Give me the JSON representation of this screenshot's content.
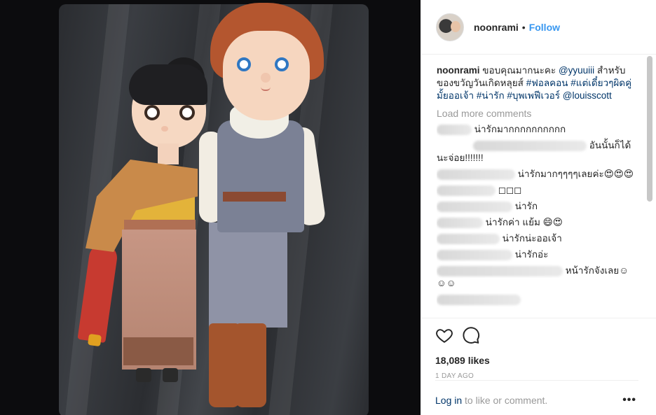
{
  "post": {
    "photo_alt": "fondant dolls in plastic bag"
  },
  "header": {
    "username": "noonrami",
    "separator": "•",
    "follow_label": "Follow"
  },
  "caption": {
    "username": "noonrami",
    "text_1": "ขอบคุณมากนะคะ",
    "mention_1": "@yyuuiii",
    "text_2": "สำหรับของขวัญวันเกิดหลุยส์",
    "tag_1": "#ฟอลคอน",
    "tag_2": "#แต่เดี๋ยวๆผิดคู่มั้ยออเจ้า",
    "tag_3": "#น่ารัก",
    "tag_4": "#บุพเพฟีเวอร์",
    "mention_2": "@louisscott"
  },
  "load_more_label": "Load more comments",
  "comments": [
    {
      "text": "น่ารักมากกกกกกกกกก"
    },
    {
      "text": "อันนั้นก็ได้นะจ่อย!!!!!!!"
    },
    {
      "text": "น่ารักมากๆๆๆๆเลยค่ะ😍😍😍"
    },
    {
      "text": "◻◻◻"
    },
    {
      "text": "น่ารัก"
    },
    {
      "text": "น่ารักค่า แย้ม 😄😍"
    },
    {
      "text": "น่ารักน่ะออเจ้า"
    },
    {
      "text": "น่ารักอ่ะ"
    },
    {
      "text": "หน้ารักจังเลย☺☺☺"
    }
  ],
  "likes_label": "18,089 likes",
  "time_ago": "1 DAY AGO",
  "login": {
    "link": "Log in",
    "suffix": " to like or comment."
  },
  "more_label": "•••",
  "icons": {
    "like": "heart-icon",
    "comment": "comment-icon"
  }
}
